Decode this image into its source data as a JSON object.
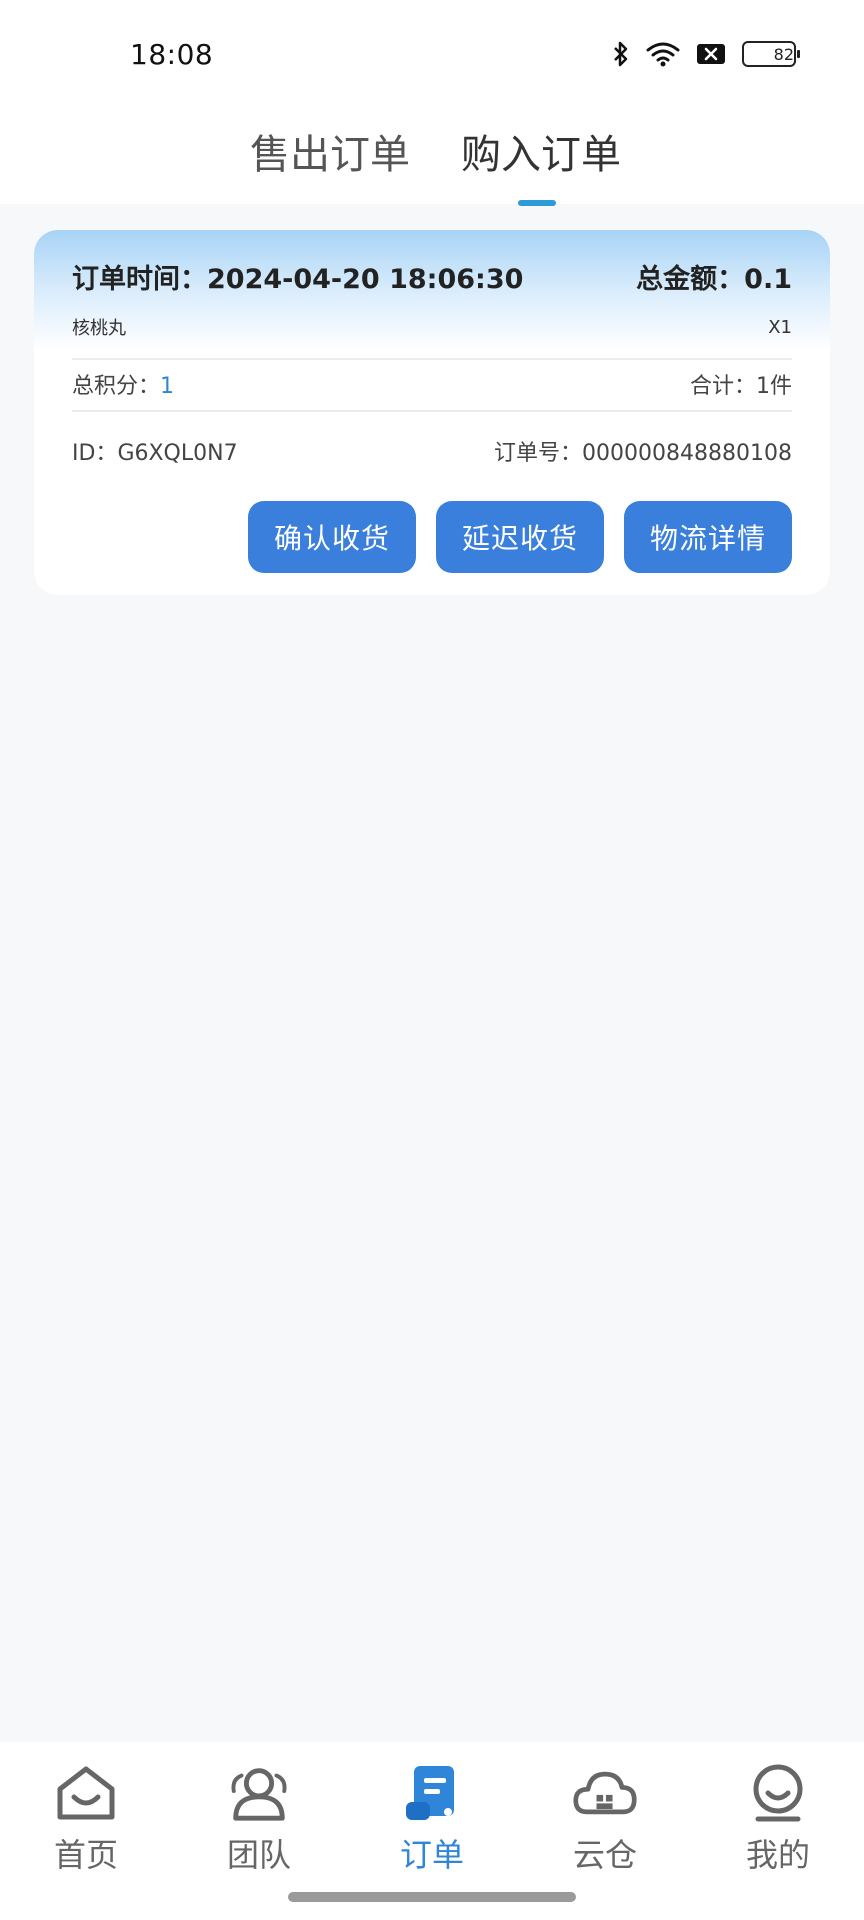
{
  "status_bar": {
    "time": "18:08",
    "battery": "82",
    "icons": [
      "bluetooth-icon",
      "wifi-icon",
      "notification-x-icon",
      "battery-icon"
    ]
  },
  "tabs": [
    {
      "label": "售出订单",
      "active": false
    },
    {
      "label": "购入订单",
      "active": true
    }
  ],
  "order": {
    "time_label": "订单时间：",
    "time_value": "2024-04-20 18:06:30",
    "total_label": "总金额：",
    "total_value": "0.1",
    "product_name": "核桃丸",
    "product_qty": "X1",
    "points_label": "总积分：",
    "points_value": "1",
    "count_label": "合计：",
    "count_value": "1件",
    "id_label": "ID：",
    "id_value": "G6XQL0N7",
    "order_no_label": "订单号：",
    "order_no_value": "000000848880108",
    "actions": [
      "确认收货",
      "延迟收货",
      "物流详情"
    ]
  },
  "bottom_nav": [
    {
      "label": "首页",
      "icon": "home-icon",
      "active": false
    },
    {
      "label": "团队",
      "icon": "team-icon",
      "active": false
    },
    {
      "label": "订单",
      "icon": "order-icon",
      "active": true
    },
    {
      "label": "云仓",
      "icon": "cloud-warehouse-icon",
      "active": false
    },
    {
      "label": "我的",
      "icon": "profile-icon",
      "active": false
    }
  ],
  "colors": {
    "accent": "#2f86d9",
    "button": "#3a7fdb",
    "background": "#f7f8fa",
    "tab_indicator": "#2f9ad8"
  }
}
